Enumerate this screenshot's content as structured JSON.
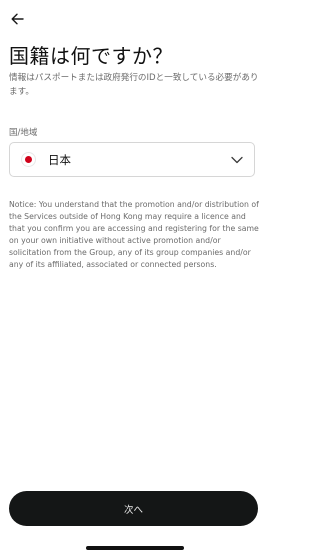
{
  "header": {
    "back_icon": "arrow-left-icon",
    "title": "国籍は何ですか？",
    "subtitle": "情報はパスポートまたは政府発行のIDと一致している必要があります。"
  },
  "form": {
    "label": "国/地域",
    "selected_country": "日本",
    "flag_icon": "japan-flag-icon",
    "dropdown_icon": "chevron-down-icon"
  },
  "notice": "Notice: You understand that the promotion and/or distribution of the Services outside of Hong Kong may require a licence and that you confirm you are accessing and registering for the same on your own initiative without active promotion and/or solicitation from the Group, any of its group companies and/or any of its affiliated, associated or connected persons.",
  "footer": {
    "next_button": "次へ"
  },
  "colors": {
    "button_bg": "#141616",
    "flag_red": "#d0021b"
  }
}
